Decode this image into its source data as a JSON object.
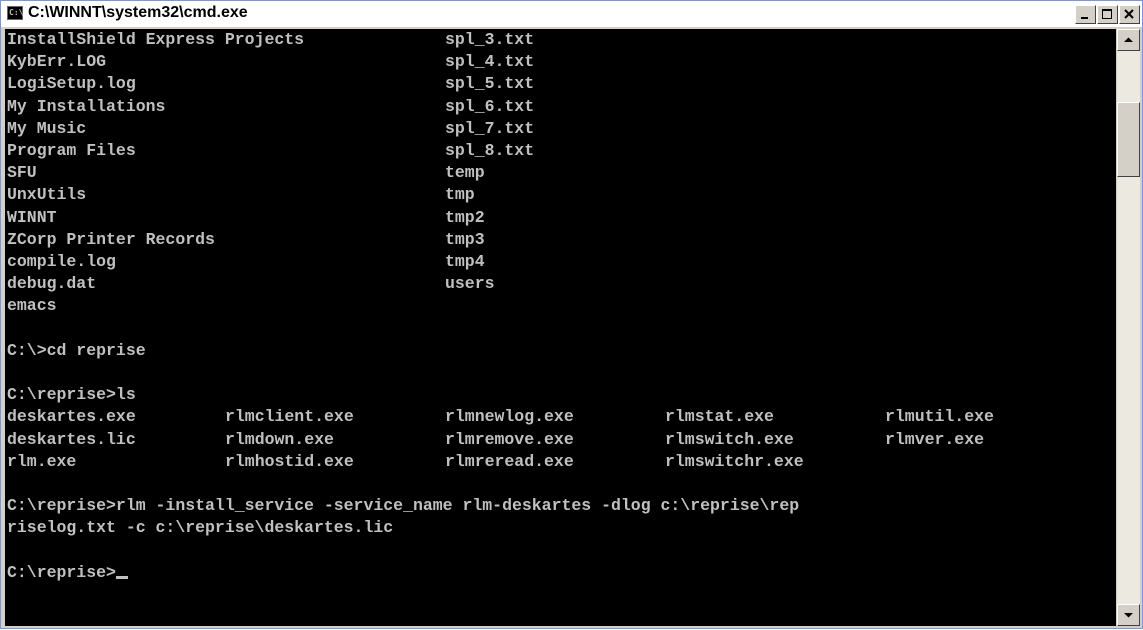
{
  "window": {
    "title": "C:\\WINNT\\system32\\cmd.exe",
    "icon_name": "cmd-icon"
  },
  "console": {
    "listing_rows": [
      [
        "InstallShield Express Projects",
        "spl_3.txt"
      ],
      [
        "KybErr.LOG",
        "spl_4.txt"
      ],
      [
        "LogiSetup.log",
        "spl_5.txt"
      ],
      [
        "My Installations",
        "spl_6.txt"
      ],
      [
        "My Music",
        "spl_7.txt"
      ],
      [
        "Program Files",
        "spl_8.txt"
      ],
      [
        "SFU",
        "temp"
      ],
      [
        "UnxUtils",
        "tmp"
      ],
      [
        "WINNT",
        "tmp2"
      ],
      [
        "ZCorp Printer Records",
        "tmp3"
      ],
      [
        "compile.log",
        "tmp4"
      ],
      [
        "debug.dat",
        "users"
      ],
      [
        "emacs",
        ""
      ]
    ],
    "cmd_cd": "C:\\>cd reprise",
    "cmd_ls": "C:\\reprise>ls",
    "ls_rows": [
      [
        "deskartes.exe",
        "rlmclient.exe",
        "rlmnewlog.exe",
        "rlmstat.exe",
        "rlmutil.exe"
      ],
      [
        "deskartes.lic",
        "rlmdown.exe",
        "rlmremove.exe",
        "rlmswitch.exe",
        "rlmver.exe"
      ],
      [
        "rlm.exe",
        "rlmhostid.exe",
        "rlmreread.exe",
        "rlmswitchr.exe",
        ""
      ]
    ],
    "cmd_install_line1": "C:\\reprise>rlm -install_service -service_name rlm-deskartes -dlog c:\\reprise\\rep",
    "cmd_install_line2": "riselog.txt -c c:\\reprise\\deskartes.lic",
    "prompt": "C:\\reprise>"
  },
  "colors": {
    "console_bg": "#000000",
    "console_fg": "#c0c0c0"
  }
}
